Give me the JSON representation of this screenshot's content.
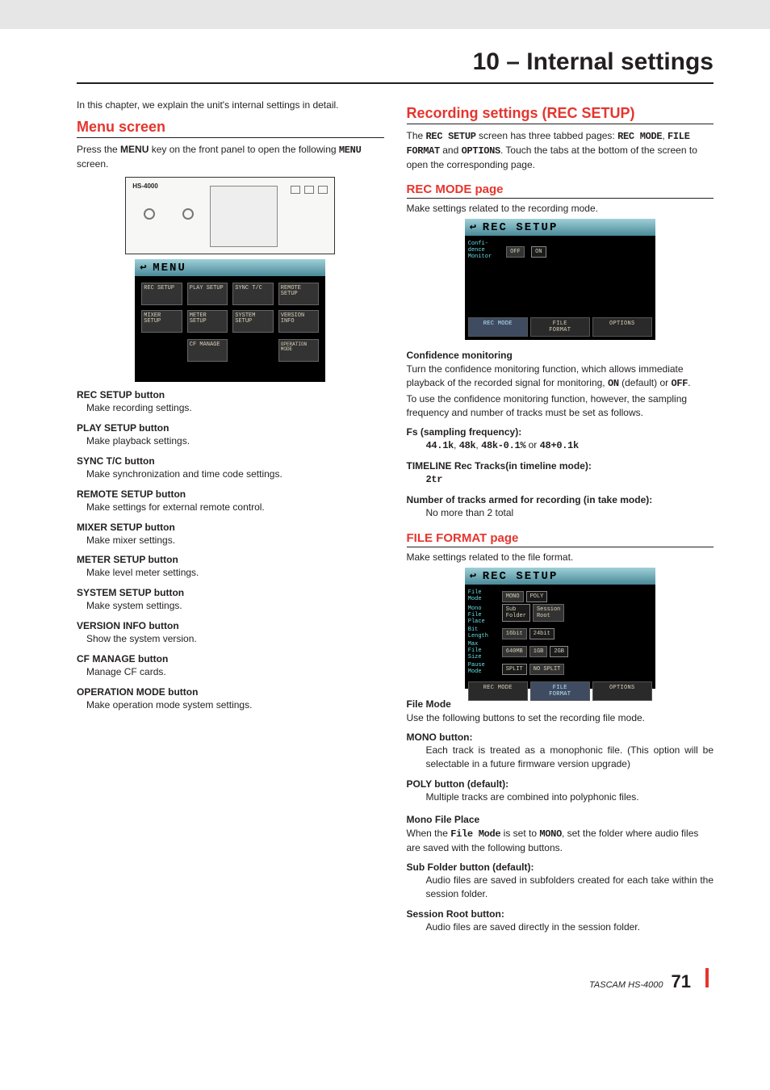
{
  "chapter_title": "10 – Internal settings",
  "left": {
    "intro": "In this chapter, we explain the unit's internal settings in detail.",
    "menu_heading": "Menu screen",
    "menu_intro_pre": "Press the ",
    "menu_intro_bold": "MENU",
    "menu_intro_mid": " key on the front panel to open the following ",
    "menu_intro_mono": "MENU",
    "menu_intro_post": " screen.",
    "device_label": "HS-4000",
    "lcd_menu_title": "MENU",
    "lcd_buttons": [
      "REC\nSETUP",
      "PLAY\nSETUP",
      "SYNC\nT/C",
      "REMOTE\nSETUP",
      "MIXER\nSETUP",
      "METER\nSETUP",
      "SYSTEM\nSETUP",
      "VERSION\nINFO"
    ],
    "lcd_cf": "CF\nMANAGE",
    "lcd_op": "OPERATION\nMODE",
    "items": [
      {
        "title": "REC SETUP button",
        "desc": "Make recording settings."
      },
      {
        "title": "PLAY SETUP button",
        "desc": "Make playback settings."
      },
      {
        "title": "SYNC T/C button",
        "desc": "Make synchronization and time code settings."
      },
      {
        "title": "REMOTE SETUP button",
        "desc": "Make settings for external remote control."
      },
      {
        "title": "MIXER SETUP button",
        "desc": "Make mixer settings."
      },
      {
        "title": "METER SETUP button",
        "desc": "Make level meter settings."
      },
      {
        "title": "SYSTEM SETUP button",
        "desc": "Make system settings."
      },
      {
        "title": "VERSION INFO button",
        "desc": "Show the system version."
      },
      {
        "title": "CF MANAGE button",
        "desc": "Manage CF cards."
      },
      {
        "title": "OPERATION MODE button",
        "desc": "Make operation mode system settings."
      }
    ]
  },
  "right": {
    "rec_heading": "Recording settings (REC SETUP)",
    "rec_intro_1": "The ",
    "rec_intro_m1": "REC SETUP",
    "rec_intro_2": " screen has three tabbed pages: ",
    "rec_intro_m2": "REC MODE",
    "rec_intro_3": ", ",
    "rec_intro_m3": "FILE FORMAT",
    "rec_intro_4": " and ",
    "rec_intro_m4": "OPTIONS",
    "rec_intro_5": ". Touch the tabs at the bottom of the screen to open the corresponding page.",
    "recmode_heading": "REC MODE page",
    "recmode_intro": "Make settings related to the recording mode.",
    "lcd_rec_title": "REC SETUP",
    "lcd_conf_lbl": "Confi-\ndence\nMonitor",
    "lcd_off": "OFF",
    "lcd_on": "ON",
    "lcd_tab_rec": "REC MODE",
    "lcd_tab_file": "FILE\nFORMAT",
    "lcd_tab_opt": "OPTIONS",
    "conf_title": "Confidence monitoring",
    "conf_1a": "Turn the confidence monitoring function, which allows immediate playback of the recorded signal for monitoring, ",
    "conf_on": "ON",
    "conf_1b": " (default) or ",
    "conf_off": "OFF",
    "conf_1c": ".",
    "conf_2": "To use the confidence monitoring function, however, the sampling frequency and number of tracks must be set as follows.",
    "fs_title": "Fs (sampling frequency):",
    "fs_m1": "44.1k",
    "fs_t1": ", ",
    "fs_m2": "48k",
    "fs_t2": ", ",
    "fs_m3": "48k-0.1%",
    "fs_t3": " or ",
    "fs_m4": "48+0.1k",
    "tl_title": "TIMELINE Rec Tracks(in timeline mode):",
    "tl_val": "2tr",
    "armed_title": "Number of tracks armed for recording (in take mode):",
    "armed_desc": "No more than 2 total",
    "ff_heading": "FILE FORMAT page",
    "ff_intro": "Make settings related to the file format.",
    "ff_rows": {
      "file_mode": {
        "lbl": "File\nMode",
        "b1": "MONO",
        "b2": "POLY"
      },
      "mono_place": {
        "lbl": "Mono\nFile\nPlace",
        "b1": "Sub\nFolder",
        "b2": "Session\nRoot"
      },
      "bit": {
        "lbl": "Bit\nLength",
        "b1": "16bit",
        "b2": "24bit"
      },
      "max": {
        "lbl": "Max\nFile\nSize",
        "b1": "640MB",
        "b2": "1GB",
        "b3": "2GB"
      },
      "pause": {
        "lbl": "Pause\nMode",
        "b1": "SPLIT",
        "b2": "NO SPLIT"
      }
    },
    "fm_title": "File Mode",
    "fm_intro": "Use the following buttons to set the recording file mode.",
    "mono_title": "MONO button:",
    "mono_desc": "Each track is treated as a monophonic file. (This option will be selectable in a future firmware version upgrade)",
    "poly_title": "POLY button (default):",
    "poly_desc": "Multiple tracks are combined into polyphonic files.",
    "mfp_title": "Mono File Place",
    "mfp_1a": "When the ",
    "mfp_m1": "File Mode",
    "mfp_1b": " is set to ",
    "mfp_m2": "MONO",
    "mfp_1c": ", set the folder where audio files are saved with the following buttons.",
    "sub_title": "Sub Folder button (default):",
    "sub_desc": "Audio files are saved in subfolders created for each take within the session folder.",
    "sr_title": "Session Root button:",
    "sr_desc": "Audio files are saved directly in the session folder."
  },
  "footer": {
    "model": "TASCAM  HS-4000",
    "page": "71"
  }
}
